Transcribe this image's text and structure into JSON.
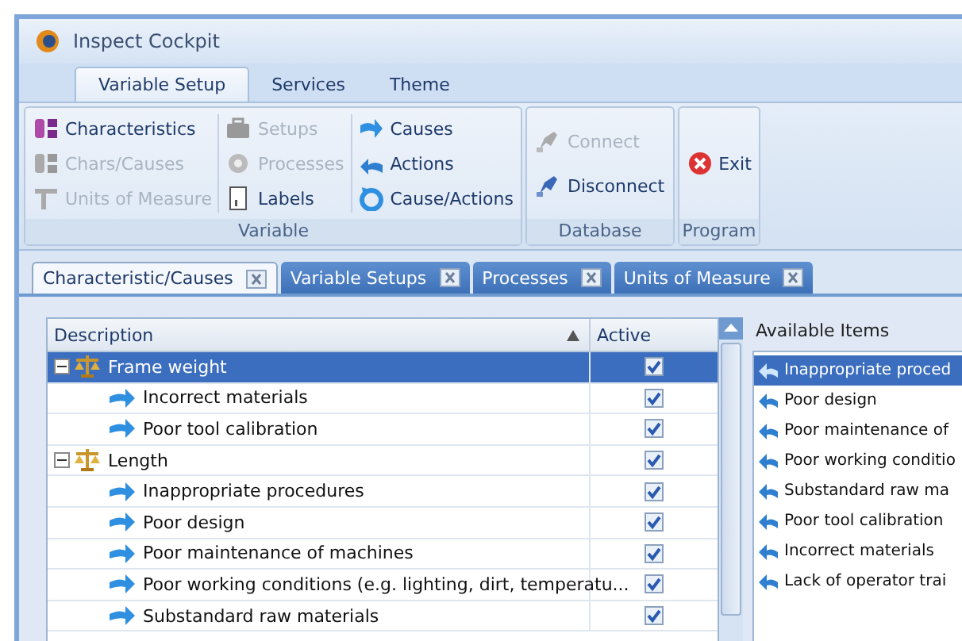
{
  "window": {
    "title": "Inspect Cockpit"
  },
  "ribbon_tabs": [
    {
      "label": "Variable Setup",
      "selected": true
    },
    {
      "label": "Services",
      "selected": false
    },
    {
      "label": "Theme",
      "selected": false
    }
  ],
  "ribbon_groups": [
    {
      "label": "Variable",
      "columns": [
        [
          {
            "kind": "characteristics",
            "label": "Characteristics",
            "disabled": false
          },
          {
            "kind": "characteristics",
            "label": "Chars/Causes",
            "disabled": true
          },
          {
            "kind": "units",
            "label": "Units of Measure",
            "disabled": true
          }
        ],
        [
          {
            "kind": "setups",
            "label": "Setups",
            "disabled": true
          },
          {
            "kind": "processes",
            "label": "Processes",
            "disabled": true
          },
          {
            "kind": "labels",
            "label": "Labels",
            "disabled": false
          }
        ],
        [
          {
            "kind": "causes",
            "label": "Causes",
            "disabled": false
          },
          {
            "kind": "actions",
            "label": "Actions",
            "disabled": false
          },
          {
            "kind": "cause-actions",
            "label": "Cause/Actions",
            "disabled": false
          }
        ]
      ]
    },
    {
      "label": "Database",
      "columns": [
        [
          {
            "kind": "connect",
            "label": "Connect",
            "disabled": true
          },
          {
            "kind": "disconnect",
            "label": "Disconnect",
            "disabled": false
          }
        ]
      ]
    },
    {
      "label": "Program",
      "columns": [
        [
          {
            "kind": "exit",
            "label": "Exit",
            "disabled": false
          }
        ]
      ]
    }
  ],
  "document_tabs": [
    {
      "label": "Characteristic/Causes",
      "selected": true
    },
    {
      "label": "Variable Setups",
      "selected": false
    },
    {
      "label": "Processes",
      "selected": false
    },
    {
      "label": "Units of Measure",
      "selected": false
    }
  ],
  "grid": {
    "columns": [
      "Description",
      "Active"
    ],
    "rows": [
      {
        "text": "Frame weight",
        "active": true,
        "selected": true,
        "expanded": true,
        "children": [
          {
            "text": "Incorrect materials",
            "active": true,
            "selected": false
          },
          {
            "text": "Poor tool calibration",
            "active": true,
            "selected": false
          }
        ]
      },
      {
        "text": "Length",
        "active": true,
        "selected": false,
        "expanded": true,
        "children": [
          {
            "text": "Inappropriate procedures",
            "active": true,
            "selected": false
          },
          {
            "text": "Poor design",
            "active": true,
            "selected": false
          },
          {
            "text": "Poor maintenance of machines",
            "active": true,
            "selected": false
          },
          {
            "text": "Poor working conditions (e.g. lighting, dirt, temperatu...",
            "active": true,
            "selected": false
          },
          {
            "text": "Substandard raw materials",
            "active": true,
            "selected": false
          }
        ]
      }
    ]
  },
  "available_items": {
    "title": "Available Items",
    "items": [
      {
        "text": "Inappropriate proced",
        "selected": true
      },
      {
        "text": "Poor design",
        "selected": false
      },
      {
        "text": "Poor maintenance of",
        "selected": false
      },
      {
        "text": "Poor working conditio",
        "selected": false
      },
      {
        "text": "Substandard raw ma",
        "selected": false
      },
      {
        "text": "Poor tool calibration",
        "selected": false
      },
      {
        "text": "Incorrect materials",
        "selected": false
      },
      {
        "text": "Lack of operator trai",
        "selected": false
      }
    ]
  }
}
